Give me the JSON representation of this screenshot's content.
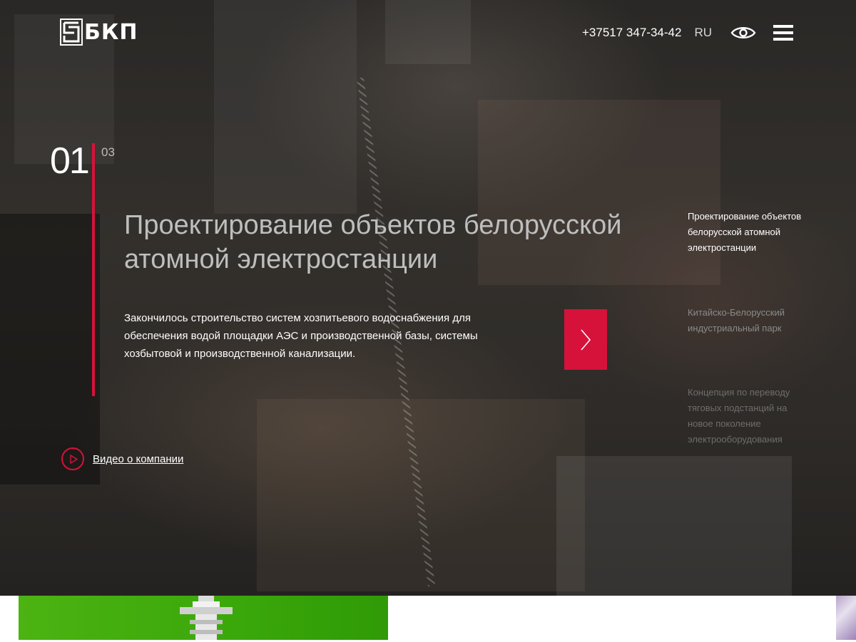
{
  "header": {
    "logo_text": "БКП",
    "phone": "+37517 347-34-42",
    "language": "RU",
    "icons": {
      "accessibility": "eye-icon",
      "menu": "menu-icon"
    }
  },
  "slide": {
    "current_number": "01",
    "total_number": "03",
    "title": "Проектирование объектов белорусской атомной электростанции",
    "description": "Закончилось строительство систем хозпитьевого водоснабжения для обеспечения водой площадки АЭС и производственной базы, системы хозбытовой и производственной канализации.",
    "next_icon": "chevron-right-icon"
  },
  "video": {
    "label": "Видео о компании",
    "icon": "play-icon"
  },
  "side_nav": {
    "items": [
      {
        "label": "Проектирование объектов белорусской атомной электростанции",
        "state": "active"
      },
      {
        "label": "Китайско-Белорусский индустриальный парк",
        "state": "inactive"
      },
      {
        "label": "Концепция по переводу тяговых подстанций на новое поколение электрооборудования",
        "state": "inactive"
      }
    ]
  },
  "colors": {
    "accent": "#d6123a",
    "text_primary": "#ffffff",
    "title_text": "#bebebe",
    "card_green": "#4cb312"
  }
}
